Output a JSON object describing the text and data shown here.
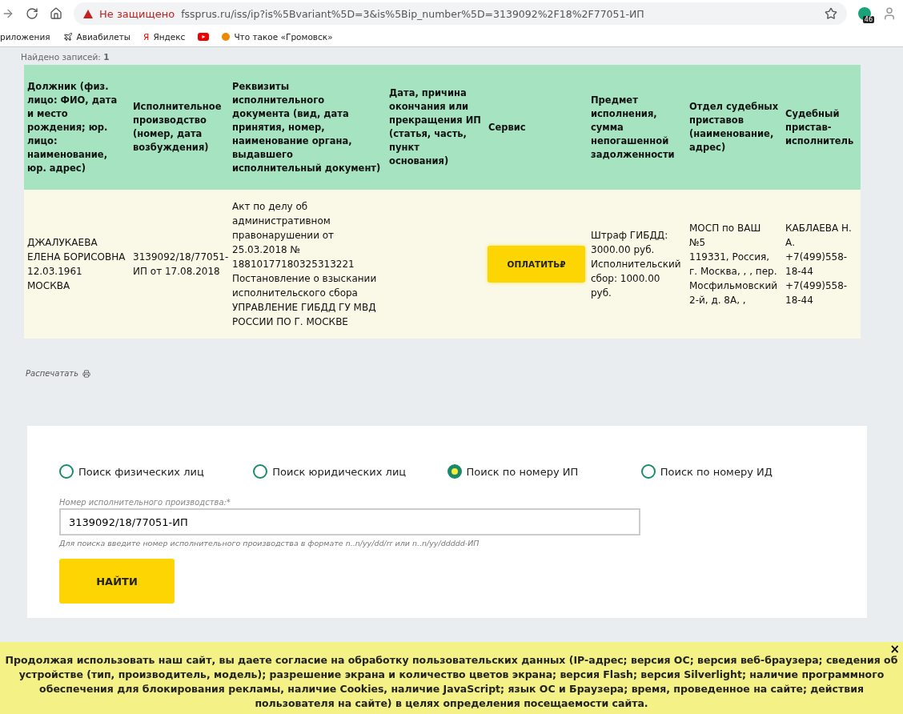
{
  "browser": {
    "security_label": "Не защищено",
    "url": "fssprus.ru/iss/ip?is%5Bvariant%5D=3&is%5Bip_number%5D=3139092%2F18%2F77051-ИП",
    "extension_badge": "46",
    "bookmarks": [
      {
        "kind": "apps",
        "label": "риложения"
      },
      {
        "kind": "plane",
        "label": "Авиабилеты"
      },
      {
        "kind": "yandex",
        "label": "Яндекс",
        "glyph": "Я"
      },
      {
        "kind": "video"
      },
      {
        "kind": "site",
        "label": "Что такое «Громовск»"
      }
    ]
  },
  "found_text": "Найдено записей: **1**",
  "table": {
    "columns": [
      "Должник (физ. лицо: ФИО, дата и место рождения; юр. лицо: наименование, юр. адрес)",
      "Исполнительное производство (номер, дата возбуждения)",
      "Реквизиты исполнительного документа (вид, дата принятия, номер, наименование органа, выдавшего исполнительный документ)",
      "Дата, причина окончания или прекращения ИП (статья, часть, пункт основания)",
      "Сервис",
      "Предмет исполнения, сумма непогашенной задолженности",
      "Отдел судебных приставов (наименование, адрес)",
      "Судебный пристав-исполнитель"
    ],
    "rows": [
      {
        "cells": [
          {
            "kind": "text",
            "lines": [
              "ДЖАЛУКАЕВА ЕЛЕНА БОРИСОВНА",
              "12.03.1961",
              "МОСКВА"
            ]
          },
          {
            "kind": "text",
            "lines": [
              "3139092/18/77051-ИП от 17.08.2018"
            ]
          },
          {
            "kind": "text",
            "lines": [
              "Акт по делу об административном правонарушении от 25.03.2018 № 18810177180325313221",
              "Постановление о взыскании исполнительского сбора",
              "УПРАВЛЕНИЕ ГИБДД ГУ МВД РОССИИ ПО Г. МОСКВЕ"
            ]
          },
          {
            "kind": "empty"
          },
          {
            "kind": "button",
            "label": "ОПЛАТИТЬ",
            "currency": "₽"
          },
          {
            "kind": "text",
            "lines": [
              "Штраф ГИБДД: 3000.00 руб.",
              "Исполнительский сбор: 1000.00 руб."
            ]
          },
          {
            "kind": "text",
            "lines": [
              "МОСП по ВАШ №5",
              "119331, Россия, г. Москва, , , пер. Мосфильмовский 2-й, д. 8А, ,"
            ]
          },
          {
            "kind": "text",
            "lines": [
              "КАБЛАЕВА Н. А.",
              "+7(499)558-18-44",
              "+7(499)558-18-44"
            ]
          }
        ]
      }
    ]
  },
  "print_link": "Распечатать",
  "search": {
    "options": [
      {
        "label": "Поиск физических лиц",
        "selected": false
      },
      {
        "label": "Поиск юридических лиц",
        "selected": false
      },
      {
        "label": "Поиск по номеру ИП",
        "selected": true
      },
      {
        "label": "Поиск по номеру ИД",
        "selected": false
      }
    ],
    "field_label": "Номер исполнительного производства:*",
    "field_value": "3139092/18/77051-ИП",
    "hint": "Для поиска введите номер исполнительного производства в формате n..n/yy/dd/rr или n..n/yy/ddddd-ИП",
    "button": "НАЙТИ"
  },
  "cookie_banner": {
    "text": "Продолжая использовать наш сайт, вы даете согласие на обработку пользовательских данных (IP-адрес; версия ОС; версия веб-браузера; сведения об устройстве (тип, производитель, модель); разрешение экрана и количество цветов экрана; версия Flash; версия Silverlight; наличие программного обеспечения для блокирования рекламы, наличие Cookies, наличие JavaScript; язык ОС и Браузера; время, проведенное на сайте; действия пользователя на сайте) в целях определения посещаемости сайта.",
    "close": "×"
  }
}
